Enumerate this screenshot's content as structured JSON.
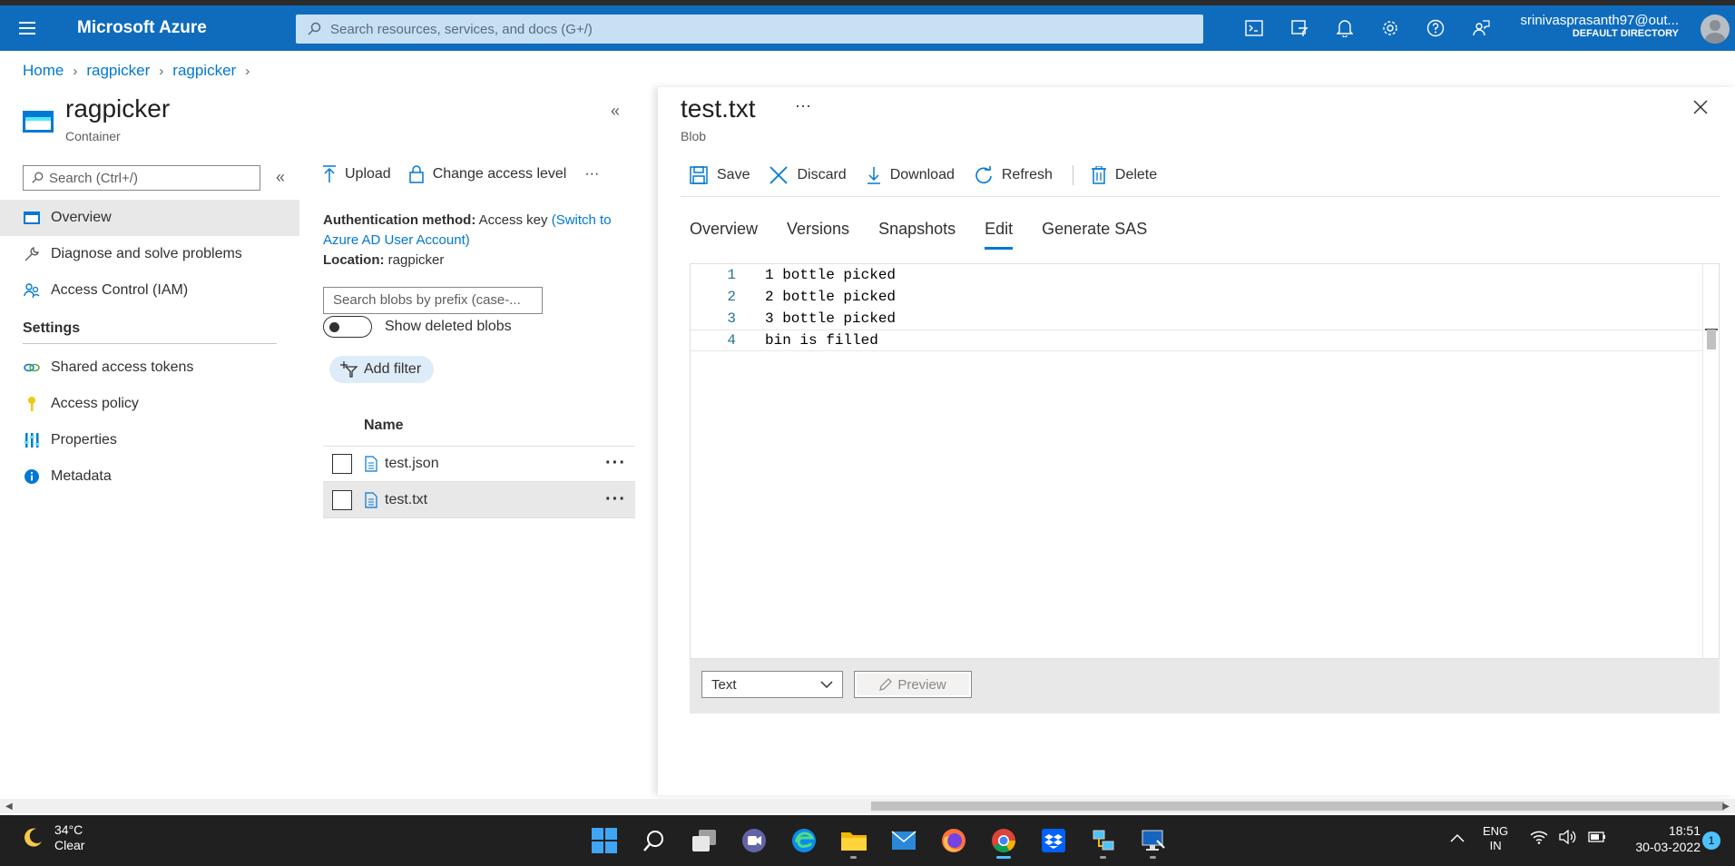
{
  "topbar": {
    "brand": "Microsoft Azure",
    "search_placeholder": "Search resources, services, and docs (G+/)",
    "account_email": "srinivasprasanth97@out...",
    "account_directory": "DEFAULT DIRECTORY",
    "icons": [
      "cloud-shell-icon",
      "directory-filter-icon",
      "notifications-icon",
      "settings-icon",
      "help-icon",
      "feedback-icon"
    ]
  },
  "breadcrumb": [
    "Home",
    "ragpicker",
    "ragpicker"
  ],
  "container": {
    "title": "ragpicker",
    "subtitle": "Container",
    "nav_search_placeholder": "Search (Ctrl+/)",
    "nav": [
      {
        "label": "Overview",
        "icon": "overview-icon",
        "active": true
      },
      {
        "label": "Diagnose and solve problems",
        "icon": "wrench-icon"
      },
      {
        "label": "Access Control (IAM)",
        "icon": "people-icon"
      }
    ],
    "settings_heading": "Settings",
    "settings_nav": [
      {
        "label": "Shared access tokens",
        "icon": "link-icon"
      },
      {
        "label": "Access policy",
        "icon": "key-icon"
      },
      {
        "label": "Properties",
        "icon": "properties-icon"
      },
      {
        "label": "Metadata",
        "icon": "info-icon"
      }
    ]
  },
  "blob_list": {
    "upload": "Upload",
    "change_access": "Change access level",
    "more": "···",
    "auth_label": "Authentication method:",
    "auth_value": "Access key",
    "auth_link": "(Switch to Azure AD User Account)",
    "location_label": "Location:",
    "location_value": "ragpicker",
    "search_placeholder": "Search blobs by prefix (case-...",
    "show_deleted": "Show deleted blobs",
    "add_filter": "Add filter",
    "column_name": "Name",
    "rows": [
      {
        "name": "test.json",
        "selected": false
      },
      {
        "name": "test.txt",
        "selected": true
      }
    ]
  },
  "blob": {
    "title": "test.txt",
    "subtitle": "Blob",
    "dots": "···",
    "commands": {
      "save": "Save",
      "discard": "Discard",
      "download": "Download",
      "refresh": "Refresh",
      "delete": "Delete"
    },
    "tabs": [
      "Overview",
      "Versions",
      "Snapshots",
      "Edit",
      "Generate SAS"
    ],
    "active_tab": "Edit",
    "lines": [
      {
        "n": "1",
        "text": "1 bottle picked"
      },
      {
        "n": "2",
        "text": "2 bottle picked"
      },
      {
        "n": "3",
        "text": "3 bottle picked"
      },
      {
        "n": "4",
        "text": "bin is filled"
      }
    ],
    "language": "Text",
    "preview": "Preview"
  },
  "taskbar": {
    "temp": "34°C",
    "condition": "Clear",
    "lang_top": "ENG",
    "lang_bottom": "IN",
    "time": "18:51",
    "date": "30-03-2022",
    "notifications": "1"
  },
  "colors": {
    "azure_blue": "#0f6cbd",
    "link": "#0078d4",
    "taskbar": "#202020"
  }
}
